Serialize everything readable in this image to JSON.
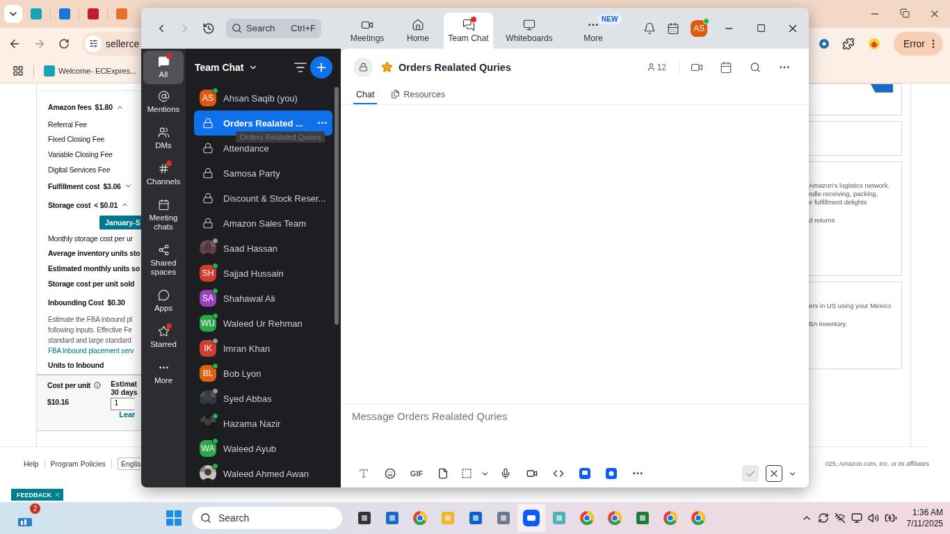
{
  "browser": {
    "address": "sellerce",
    "profile_button": "Error",
    "bookmarks": [
      "Welcome- ECExpres..."
    ],
    "page": {
      "rows": [
        {
          "kind": "heading",
          "label": "Amazon fees",
          "value": "$1.80",
          "expanded": true
        },
        {
          "kind": "item",
          "label": "Referral Fee"
        },
        {
          "kind": "item",
          "label": "Fixed Closing Fee"
        },
        {
          "kind": "item",
          "label": "Variable Closing Fee"
        },
        {
          "kind": "item",
          "label": "Digital Services Fee"
        },
        {
          "kind": "heading",
          "label": "Fulfillment cost",
          "value": "$3.06",
          "expanded": false
        },
        {
          "kind": "heading",
          "label": "Storage cost",
          "value": "< $0.01",
          "expanded": true
        },
        {
          "kind": "button",
          "label": "January-S"
        },
        {
          "kind": "item",
          "label": "Monthly storage cost per ur"
        },
        {
          "kind": "bold",
          "label": "Average inventory units sto"
        },
        {
          "kind": "bold",
          "label": "Estimated monthly units so"
        },
        {
          "kind": "bold",
          "label": "Storage cost per unit sold"
        },
        {
          "kind": "heading",
          "label": "Inbounding Cost",
          "value": "$0.30"
        }
      ],
      "description": [
        "Estimate the FBA inbound pl",
        "following inputs. Effective Fe",
        "standard and large standard"
      ],
      "description_link": "FBA Inbound placement serv",
      "units_label": "Units to Inbound",
      "summary": {
        "cost_label": "Cost per unit",
        "cost_value": "$10.16",
        "estimate_label": "Estimat",
        "estimate_sub": "30 days",
        "estimate_value": "1",
        "learn_link": "Lear"
      },
      "cards": [
        {
          "new_badge": true
        },
        {
          "new_badge": false
        },
        {
          "new_badge": false,
          "paragraphs": [
            [
              "Amazon's logistics network.",
              "ndle receiving, packing,",
              "e fulfillment delights"
            ],
            [
              "d returns"
            ]
          ]
        },
        {
          "new_badge": false,
          "paragraphs": [
            [
              "ers in US using your Mexico"
            ],
            [
              "BA inventory."
            ]
          ]
        }
      ]
    },
    "footer": {
      "links": [
        "Help",
        "Program Policies"
      ],
      "language": "Englis",
      "copyright": "025, Amazon.com, Inc. or its affiliates"
    },
    "feedback": "FEEDBACK"
  },
  "zoom": {
    "top_bar": {
      "search": "Search",
      "shortcut": "Ctrl+F",
      "tabs": [
        {
          "label": "Meetings",
          "selected": false,
          "dot": false
        },
        {
          "label": "Home",
          "selected": false,
          "dot": false
        },
        {
          "label": "Team Chat",
          "selected": true,
          "dot": true
        },
        {
          "label": "Whiteboards",
          "selected": false,
          "dot": false
        },
        {
          "label": "More",
          "selected": false,
          "dot": false,
          "badge": "NEW"
        }
      ],
      "avatar": {
        "initials": "AS",
        "color": "#e0570e",
        "online": true
      }
    },
    "rail": [
      {
        "label": "All",
        "selected": true,
        "badge": true
      },
      {
        "label": "Mentions",
        "selected": false,
        "badge": false
      },
      {
        "label": "DMs",
        "selected": false,
        "badge": false
      },
      {
        "label": "Channels",
        "selected": false,
        "badge": true
      },
      {
        "label": "Meeting chats",
        "selected": false,
        "badge": false
      },
      {
        "label": "Shared spaces",
        "selected": false,
        "badge": false
      },
      {
        "label": "Apps",
        "selected": false,
        "badge": false
      },
      {
        "label": "Starred",
        "selected": false,
        "badge": true
      },
      {
        "label": "More",
        "selected": false,
        "badge": false
      }
    ],
    "chat_list": {
      "title": "Team Chat",
      "tooltip": "Orders Realated Quries",
      "items": [
        {
          "kind": "person",
          "name": "Ahsan Saqib (you)",
          "initials": "AS",
          "color": "#e0570e",
          "online": true,
          "selected": false
        },
        {
          "kind": "channel",
          "name": "Orders Realated ...",
          "selected": true
        },
        {
          "kind": "channel",
          "name": "Attendance",
          "selected": false
        },
        {
          "kind": "channel",
          "name": "Samosa Party",
          "selected": false
        },
        {
          "kind": "channel",
          "name": "Discount & Stock Reser...",
          "selected": false
        },
        {
          "kind": "channel",
          "name": "Amazon Sales Team",
          "selected": false
        },
        {
          "name": "Saad Hassan",
          "online": false,
          "selected": false
        },
        {
          "kind": "person",
          "name": "Sajjad Hussain",
          "initials": "SH",
          "color": "#d13d2e",
          "online": true,
          "selected": false
        },
        {
          "kind": "person",
          "name": "Shahawal Ali",
          "initials": "SA",
          "color": "#9a3fbf",
          "online": true,
          "selected": false
        },
        {
          "kind": "person",
          "name": "Waleed Ur Rehman",
          "initials": "WU",
          "color": "#2aa84a",
          "online": true,
          "selected": false
        },
        {
          "kind": "person",
          "name": "Imran Khan",
          "initials": "IK",
          "color": "#d13d2e",
          "online": false,
          "selected": false
        },
        {
          "kind": "person",
          "name": "Bob Lyon",
          "initials": "BL",
          "color": "#e0600e",
          "online": true,
          "selected": false
        },
        {
          "name": "Syed Abbas",
          "online": false,
          "selected": false
        },
        {
          "name": "Hazama Nazir",
          "online": true,
          "selected": false
        },
        {
          "kind": "person",
          "name": "Waleed Ayub",
          "initials": "WA",
          "color": "#2aa84a",
          "online": true,
          "selected": false
        },
        {
          "name": "Waleed Ahmed Awan",
          "online": true,
          "selected": false
        }
      ]
    },
    "channel": {
      "title": "Orders Realated Quries",
      "starred": true,
      "members": "12",
      "tabs": [
        {
          "label": "Chat",
          "selected": true
        },
        {
          "label": "Resources",
          "selected": false
        }
      ],
      "composer_placeholder": "Message Orders Realated Quries",
      "gif": "GIF",
      "send_enabled": false
    }
  },
  "taskbar": {
    "widget_badge": "2",
    "search": "Search",
    "time": "1:36 AM",
    "date": "7/11/2025"
  }
}
